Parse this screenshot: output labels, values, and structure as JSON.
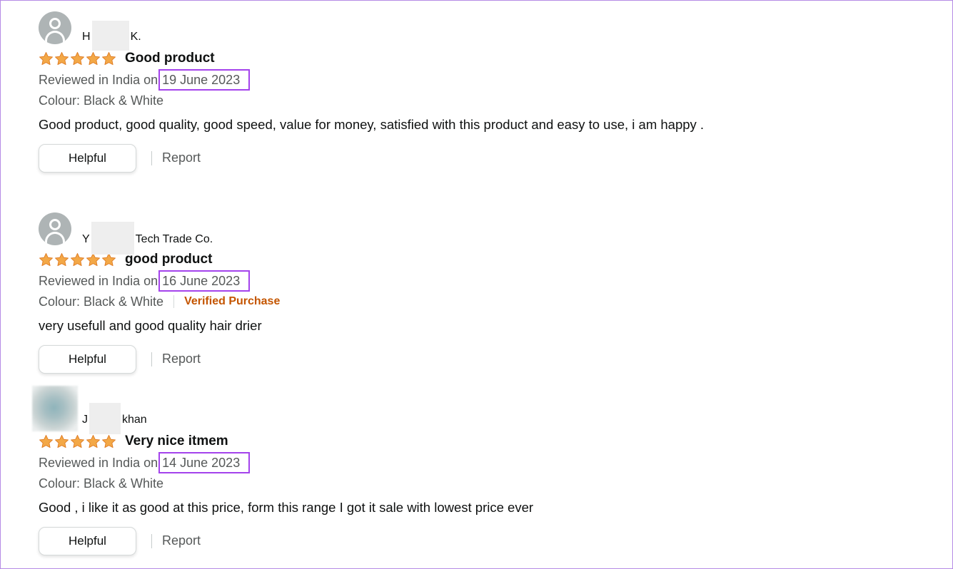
{
  "colors": {
    "star": "#f3a847",
    "date_highlight": "#a443ec",
    "verified": "#c45500",
    "muted_text": "#565959"
  },
  "reviews": [
    {
      "name_prefix": "H",
      "name_suffix": "K.",
      "avatar": "default-profile-icon",
      "rating": 5,
      "title": "Good product",
      "reviewed_prefix": "Reviewed in India on",
      "date": "19 June 2023",
      "colour": "Colour: Black & White",
      "verified": "",
      "body": "Good product, good quality, good speed, value for money, satisfied with this product and easy to use, i am happy .",
      "helpful_label": "Helpful",
      "report_label": "Report"
    },
    {
      "name_prefix": "Y",
      "name_suffix": "Tech Trade Co.",
      "avatar": "default-profile-icon",
      "rating": 5,
      "title": "good product",
      "reviewed_prefix": "Reviewed in India on",
      "date": "16 June 2023",
      "colour": "Colour: Black & White",
      "verified": "Verified Purchase",
      "body": "very usefull and good quality hair drier",
      "helpful_label": "Helpful",
      "report_label": "Report"
    },
    {
      "name_prefix": "J",
      "name_suffix": "khan",
      "avatar": "blurred-photo",
      "rating": 5,
      "title": "Very nice itmem",
      "reviewed_prefix": "Reviewed in India on",
      "date": "14 June 2023",
      "colour": "Colour: Black & White",
      "verified": "",
      "body": "Good , i like it as good at this price, form this range I got it sale with lowest price ever",
      "helpful_label": "Helpful",
      "report_label": "Report"
    }
  ]
}
